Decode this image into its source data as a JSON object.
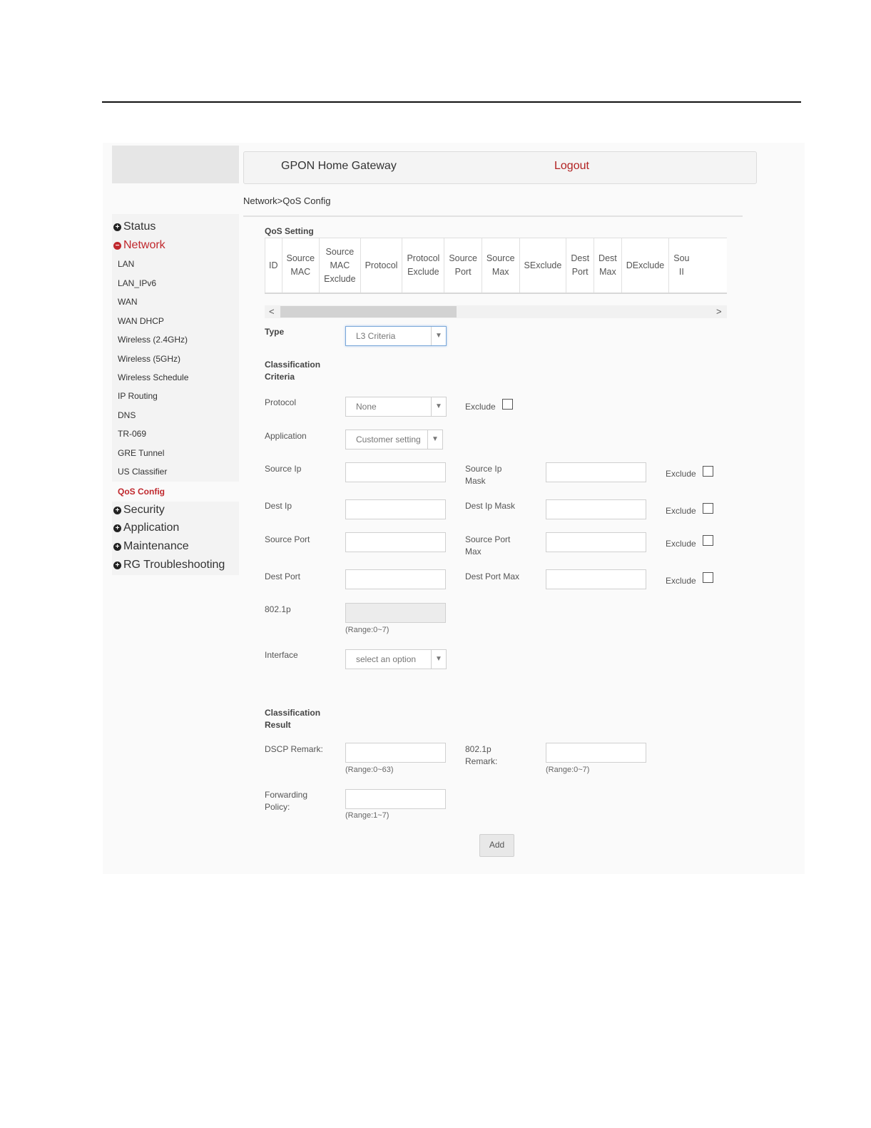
{
  "header": {
    "title": "GPON Home Gateway",
    "logout": "Logout"
  },
  "breadcrumb": "Network>QoS Config",
  "sidebar": {
    "categories": {
      "status": "Status",
      "network": "Network",
      "security": "Security",
      "application": "Application",
      "maintenance": "Maintenance",
      "troubleshooting": "RG Troubleshooting"
    },
    "network_items": [
      "LAN",
      "LAN_IPv6",
      "WAN",
      "WAN DHCP",
      "Wireless (2.4GHz)",
      "Wireless (5GHz)",
      "Wireless Schedule",
      "IP Routing",
      "DNS",
      "TR-069",
      "GRE Tunnel",
      "US Classifier",
      "QoS Config"
    ]
  },
  "qos": {
    "section_title": "QoS Setting",
    "columns": {
      "id": "ID",
      "source_mac_1": "Source",
      "source_mac_2": "MAC",
      "smac_excl_1": "Source",
      "smac_excl_2": "MAC",
      "smac_excl_3": "Exclude",
      "protocol": "Protocol",
      "proto_excl_1": "Protocol",
      "proto_excl_2": "Exclude",
      "sport_1": "Source",
      "sport_2": "Port",
      "smax_1": "Source",
      "smax_2": "Max",
      "sexclude": "SExclude",
      "dport_1": "Dest",
      "dport_2": "Port",
      "dmax_1": "Dest",
      "dmax_2": "Max",
      "dexclude": "DExclude",
      "sip_1": "Sou",
      "sip_2": "II"
    }
  },
  "form": {
    "type_label": "Type",
    "type_value": "L3 Criteria",
    "criteria_heading_1": "Classification",
    "criteria_heading_2": "Criteria",
    "protocol_label": "Protocol",
    "protocol_value": "None",
    "exclude": "Exclude",
    "application_label": "Application",
    "application_value": "Customer setting",
    "source_ip": "Source Ip",
    "source_ip_mask_1": "Source Ip",
    "source_ip_mask_2": "Mask",
    "dest_ip": "Dest Ip",
    "dest_ip_mask": "Dest Ip Mask",
    "source_port": "Source Port",
    "source_port_max_1": "Source Port",
    "source_port_max_2": "Max",
    "dest_port": "Dest Port",
    "dest_port_max": "Dest Port Max",
    "p8021": "802.1p",
    "range_0_7": "(Range:0~7)",
    "interface_label": "Interface",
    "interface_value": "select an option",
    "result_heading_1": "Classification",
    "result_heading_2": "Result",
    "dscp_label": "DSCP Remark:",
    "range_0_63": "(Range:0~63)",
    "p8021_remark_1": "802.1p",
    "p8021_remark_2": "Remark:",
    "forwarding_1": "Forwarding",
    "forwarding_2": "Policy:",
    "range_1_7": "(Range:1~7)",
    "add_button": "Add"
  }
}
